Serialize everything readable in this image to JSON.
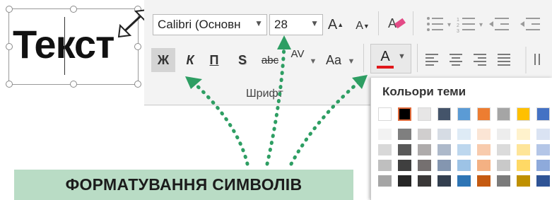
{
  "slide": {
    "text": "Текст"
  },
  "ribbon": {
    "font_name": "Calibri (Основн",
    "font_size": "28",
    "grow_font": "A",
    "shrink_font": "A",
    "bold_label": "Ж",
    "italic_label": "К",
    "underline_label": "П",
    "shadow_label": "S",
    "strike_label": "abc",
    "spacing_label": "AV",
    "case_label": "Aa",
    "font_color_label": "A",
    "group_label": "Шрифт",
    "font_color_current": "#e0181b"
  },
  "palette": {
    "title": "Кольори теми",
    "theme_colors": [
      "#ffffff",
      "#000000",
      "#e7e6e6",
      "#44546a",
      "#5b9bd5",
      "#ed7d31",
      "#a5a5a5",
      "#ffc000",
      "#4472c4"
    ],
    "shades": [
      [
        "#f2f2f2",
        "#7f7f7f",
        "#d0cece",
        "#d6dce4",
        "#deebf6",
        "#fbe5d5",
        "#ededed",
        "#fff2cc",
        "#dae3f3"
      ],
      [
        "#d8d8d8",
        "#595959",
        "#aeabab",
        "#adb9ca",
        "#bdd7ee",
        "#f8cbad",
        "#dbdbdb",
        "#fee599",
        "#b4c6e7"
      ],
      [
        "#bfbfbf",
        "#3f3f3f",
        "#757070",
        "#8496b0",
        "#9dc3e6",
        "#f4b183",
        "#c9c9c9",
        "#ffd965",
        "#8eaadb"
      ],
      [
        "#a5a5a5",
        "#262626",
        "#3a3838",
        "#333f4f",
        "#2e75b5",
        "#c55a11",
        "#7b7b7b",
        "#bf9000",
        "#2f5496"
      ]
    ]
  },
  "banner": {
    "text": "ФОРМАТУВАННЯ СИМВОЛІВ"
  },
  "colors": {
    "arrow_green": "#2e9e63",
    "banner_bg": "#b9dcc5",
    "selected_border": "#e06a3a"
  }
}
